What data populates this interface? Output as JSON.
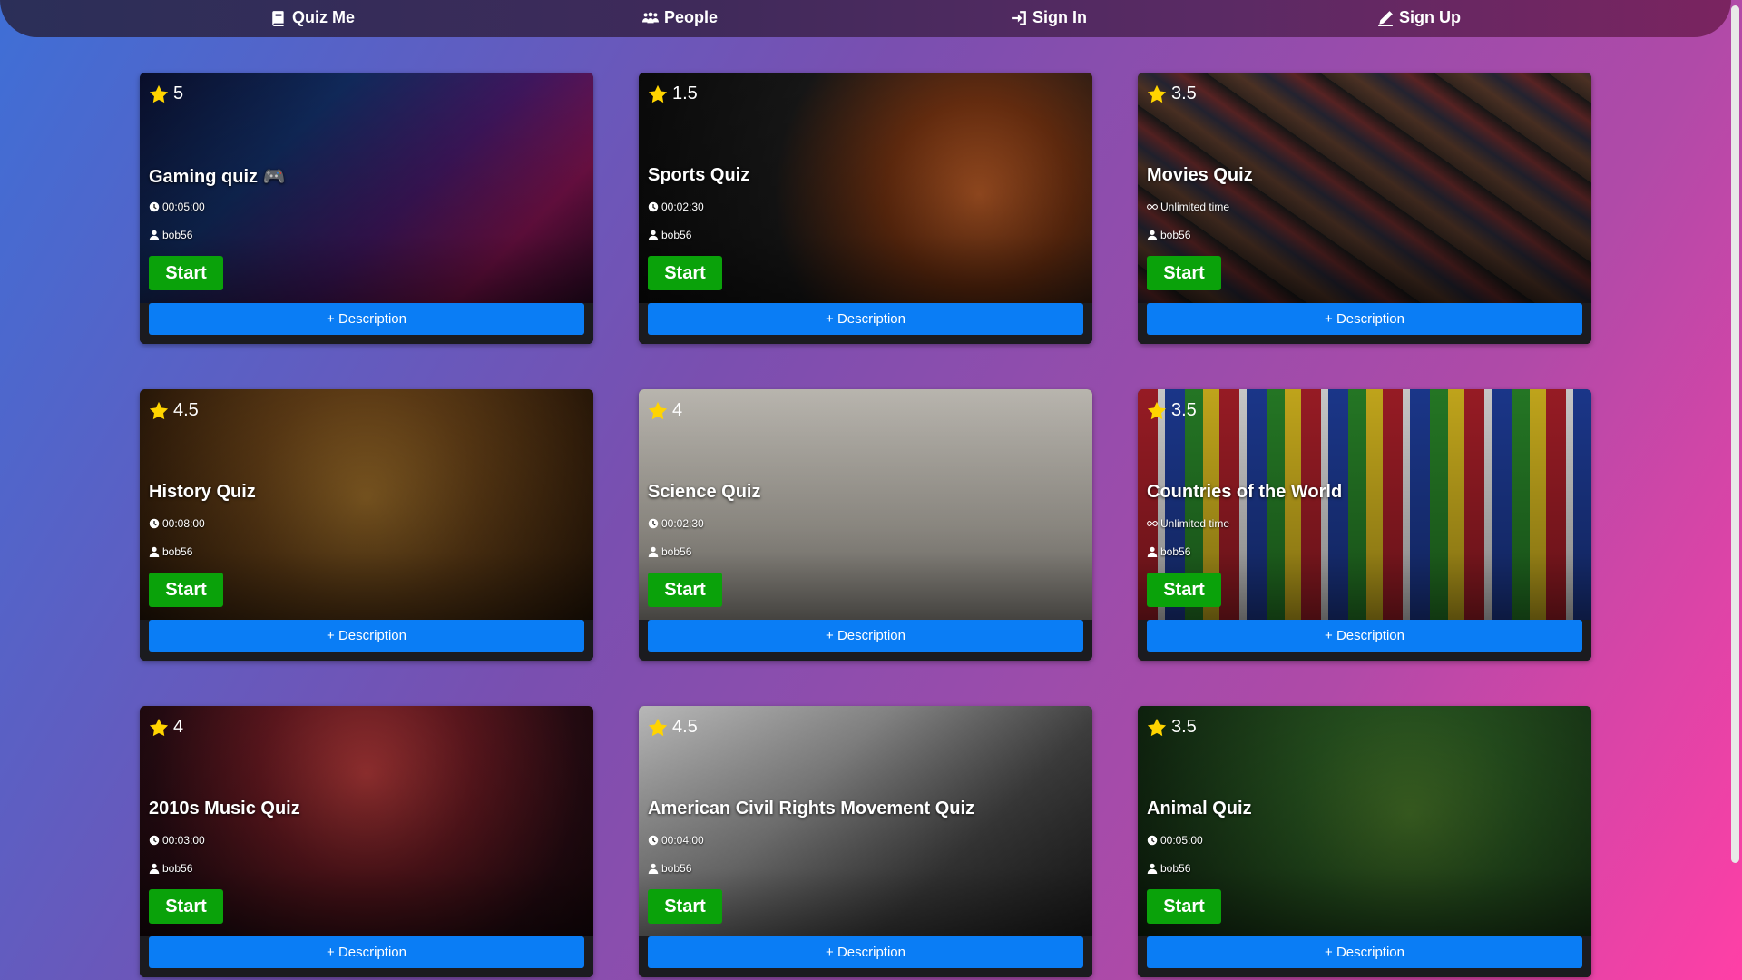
{
  "nav": {
    "items": [
      {
        "label": "Quiz Me",
        "icon": "book-icon"
      },
      {
        "label": "People",
        "icon": "people-icon"
      },
      {
        "label": "Sign In",
        "icon": "sign-in-icon"
      },
      {
        "label": "Sign Up",
        "icon": "pencil-icon"
      }
    ]
  },
  "colors": {
    "start_button": "#0aa20a",
    "description_button": "#0a7df5",
    "star": "#ffd400"
  },
  "description_label": "+ Description",
  "start_label": "Start",
  "cards": [
    {
      "rating": "5",
      "title": "Gaming quiz 🎮",
      "time": "00:05:00",
      "time_icon": "clock-icon",
      "author": "bob56",
      "bg": "linear-gradient(135deg,#0b1030 0%,#13306a 30%,#4a1a6e 55%,#8a1456 75%,#1a0820 100%)"
    },
    {
      "rating": "1.5",
      "title": "Sports Quiz",
      "time": "00:02:30",
      "time_icon": "clock-icon",
      "author": "bob56",
      "bg": "radial-gradient(circle at 75% 45%,#c8632a 0%,#7a3512 25%,#1a1a1a 55%,#0a0a0a 100%)"
    },
    {
      "rating": "3.5",
      "title": "Movies Quiz",
      "time": "Unlimited time",
      "time_icon": "infinity-icon",
      "author": "bob56",
      "bg": "repeating-linear-gradient(35deg,#3a2a22 0px,#5a3a2a 18px,#2a2a3a 36px,#6a2a2a 54px,#1a1a1a 72px)"
    },
    {
      "rating": "4.5",
      "title": "History Quiz",
      "time": "00:08:00",
      "time_icon": "clock-icon",
      "author": "bob56",
      "bg": "radial-gradient(circle at 50% 40%,#a0702a 0%,#6a4318 40%,#3a220c 80%,#1e1206 100%)"
    },
    {
      "rating": "4",
      "title": "Science Quiz",
      "time": "00:02:30",
      "time_icon": "clock-icon",
      "author": "bob56",
      "bg": "linear-gradient(180deg,#d8d4cc 0%,#c9c4ba 50%,#9e9a92 100%)"
    },
    {
      "rating": "3.5",
      "title": "Countries of the World",
      "time": "Unlimited time",
      "time_icon": "infinity-icon",
      "author": "bob56",
      "bg": "repeating-linear-gradient(90deg,#b0202a 0px,#b0202a 22px,#e8e8e8 22px,#e8e8e8 30px,#1f3fa0 30px,#1f3fa0 52px,#2a8a2a 52px,#2a8a2a 72px,#e0c020 72px,#e0c020 90px)"
    },
    {
      "rating": "4",
      "title": "2010s Music Quiz",
      "time": "00:03:00",
      "time_icon": "clock-icon",
      "author": "bob56",
      "bg": "radial-gradient(circle at 50% 25%,#b43a3a 0%,#6a1a22 35%,#2a0c14 70%,#120608 100%)"
    },
    {
      "rating": "4.5",
      "title": "American Civil Rights Movement Quiz",
      "time": "00:04:00",
      "time_icon": "clock-icon",
      "author": "bob56",
      "bg": "linear-gradient(135deg,#d8d8d8 0%,#9a9a9a 35%,#4a4a4a 65%,#1a1a1a 100%)"
    },
    {
      "rating": "3.5",
      "title": "Animal Quiz",
      "time": "00:05:00",
      "time_icon": "clock-icon",
      "author": "bob56",
      "bg": "radial-gradient(circle at 60% 40%,#4a7a2a 0%,#2a5a22 35%,#1a3a18 70%,#0c1e0c 100%)"
    }
  ]
}
